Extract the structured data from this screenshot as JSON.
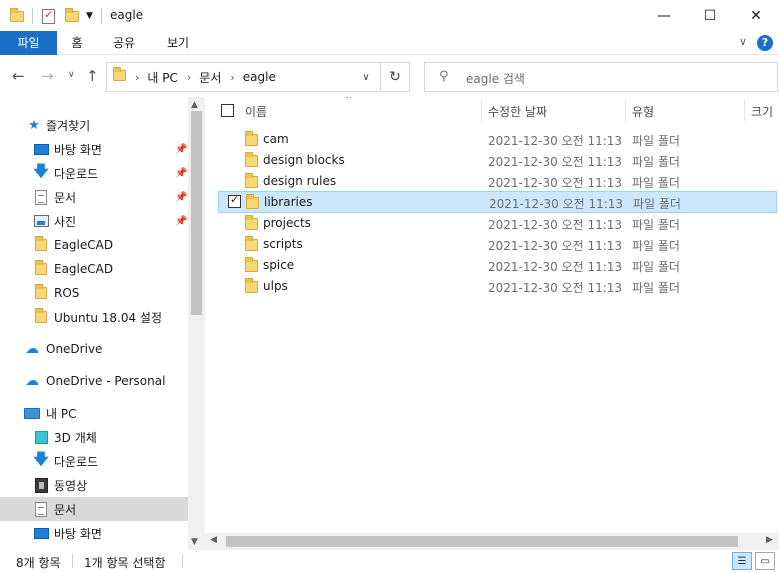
{
  "window": {
    "title": "eagle",
    "minimize": "—",
    "maximize": "☐",
    "close": "✕"
  },
  "ribbon": {
    "tabs": [
      "파일",
      "홈",
      "공유",
      "보기"
    ]
  },
  "address": {
    "crumbs": [
      "내 PC",
      "문서",
      "eagle"
    ],
    "search_placeholder": "eagle 검색"
  },
  "nav": {
    "quick_access": "즐겨찾기",
    "items": [
      {
        "label": "바탕 화면",
        "icon": "desktop-icon",
        "pinned": true
      },
      {
        "label": "다운로드",
        "icon": "download-icon",
        "pinned": true
      },
      {
        "label": "문서",
        "icon": "document-icon",
        "pinned": true
      },
      {
        "label": "사진",
        "icon": "pictures-icon",
        "pinned": true
      },
      {
        "label": "EagleCAD",
        "icon": "folder-icon"
      },
      {
        "label": "EagleCAD",
        "icon": "folder-icon"
      },
      {
        "label": "ROS",
        "icon": "folder-icon"
      },
      {
        "label": "Ubuntu 18.04 설정",
        "icon": "folder-icon"
      }
    ],
    "onedrive": "OneDrive",
    "onedrive_personal": "OneDrive - Personal",
    "this_pc": "내 PC",
    "pc_items": [
      {
        "label": "3D 개체",
        "icon": "3d-objects-icon"
      },
      {
        "label": "다운로드",
        "icon": "download-icon"
      },
      {
        "label": "동영상",
        "icon": "videos-icon"
      },
      {
        "label": "문서",
        "icon": "document-icon",
        "selected": true
      },
      {
        "label": "바탕 화면",
        "icon": "desktop-icon"
      }
    ]
  },
  "columns": {
    "name": "이름",
    "modified": "수정한 날짜",
    "type": "유형",
    "size": "크기"
  },
  "files": [
    {
      "name": "cam",
      "date": "2021-12-30 오전 11:13",
      "type": "파일 폴더",
      "selected": false
    },
    {
      "name": "design blocks",
      "date": "2021-12-30 오전 11:13",
      "type": "파일 폴더",
      "selected": false
    },
    {
      "name": "design rules",
      "date": "2021-12-30 오전 11:13",
      "type": "파일 폴더",
      "selected": false
    },
    {
      "name": "libraries",
      "date": "2021-12-30 오전 11:13",
      "type": "파일 폴더",
      "selected": true
    },
    {
      "name": "projects",
      "date": "2021-12-30 오전 11:13",
      "type": "파일 폴더",
      "selected": false
    },
    {
      "name": "scripts",
      "date": "2021-12-30 오전 11:13",
      "type": "파일 폴더",
      "selected": false
    },
    {
      "name": "spice",
      "date": "2021-12-30 오전 11:13",
      "type": "파일 폴더",
      "selected": false
    },
    {
      "name": "ulps",
      "date": "2021-12-30 오전 11:13",
      "type": "파일 폴더",
      "selected": false
    }
  ],
  "status": {
    "count": "8개 항목",
    "selection": "1개 항목 선택함"
  },
  "colors": {
    "accent": "#1a6fc7",
    "selection": "#cce8ff",
    "folder": "#f8d775"
  }
}
